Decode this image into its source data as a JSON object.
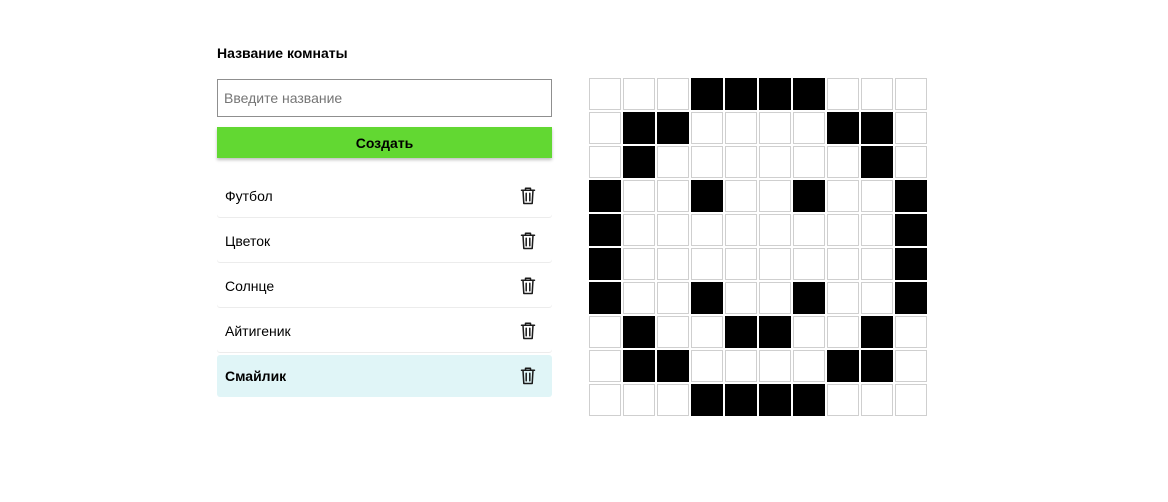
{
  "room_form": {
    "label": "Название комнаты",
    "input_placeholder": "Введите название",
    "input_value": "",
    "create_label": "Создать"
  },
  "rooms": [
    {
      "name": "Футбол",
      "active": false
    },
    {
      "name": "Цветок",
      "active": false
    },
    {
      "name": "Солнце",
      "active": false
    },
    {
      "name": "Айтигеник",
      "active": false
    },
    {
      "name": "Смайлик",
      "active": true
    }
  ],
  "icons": {
    "delete": "trash-icon"
  },
  "colors": {
    "create_button": "#62d832",
    "active_room_bg": "#e0f5f7",
    "cell_on": "#000000",
    "cell_off": "#ffffff"
  },
  "pixel_grid": {
    "rows": 10,
    "cols": 10,
    "cells": [
      [
        0,
        0,
        0,
        1,
        1,
        1,
        1,
        0,
        0,
        0
      ],
      [
        0,
        1,
        1,
        0,
        0,
        0,
        0,
        1,
        1,
        0
      ],
      [
        0,
        1,
        0,
        0,
        0,
        0,
        0,
        0,
        1,
        0
      ],
      [
        1,
        0,
        0,
        1,
        0,
        0,
        1,
        0,
        0,
        1
      ],
      [
        1,
        0,
        0,
        0,
        0,
        0,
        0,
        0,
        0,
        1
      ],
      [
        1,
        0,
        0,
        0,
        0,
        0,
        0,
        0,
        0,
        1
      ],
      [
        1,
        0,
        0,
        1,
        0,
        0,
        1,
        0,
        0,
        1
      ],
      [
        0,
        1,
        0,
        0,
        1,
        1,
        0,
        0,
        1,
        0
      ],
      [
        0,
        1,
        1,
        0,
        0,
        0,
        0,
        1,
        1,
        0
      ],
      [
        0,
        0,
        0,
        1,
        1,
        1,
        1,
        0,
        0,
        0
      ]
    ]
  }
}
